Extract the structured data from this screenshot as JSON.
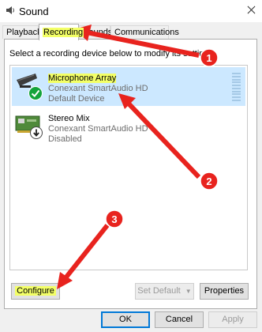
{
  "window": {
    "title": "Sound",
    "icon": "speaker-icon",
    "close_icon": "close-icon"
  },
  "tabs": [
    {
      "label": "Playback",
      "active": false
    },
    {
      "label": "Recording",
      "active": true
    },
    {
      "label": "Sounds",
      "active": false
    },
    {
      "label": "Communications",
      "active": false
    }
  ],
  "instruction": "Select a recording device below to modify its settings:",
  "devices": [
    {
      "name": "Microphone Array",
      "driver": "Conexant SmartAudio HD",
      "status": "Default Device",
      "icon": "microphone-array-icon",
      "badge": "check-icon",
      "selected": true
    },
    {
      "name": "Stereo Mix",
      "driver": "Conexant SmartAudio HD",
      "status": "Disabled",
      "icon": "sound-card-icon",
      "badge": "down-arrow-icon",
      "selected": false
    }
  ],
  "buttons": {
    "configure": "Configure",
    "set_default": "Set Default",
    "set_default_arrow": "▼",
    "properties": "Properties",
    "ok": "OK",
    "cancel": "Cancel",
    "apply": "Apply"
  },
  "annotations": [
    {
      "label": "1"
    },
    {
      "label": "2"
    },
    {
      "label": "3"
    }
  ],
  "colors": {
    "highlight": "#f3ff66",
    "selection": "#cce8ff",
    "annotation": "#e8231e",
    "focus": "#0078d7"
  }
}
